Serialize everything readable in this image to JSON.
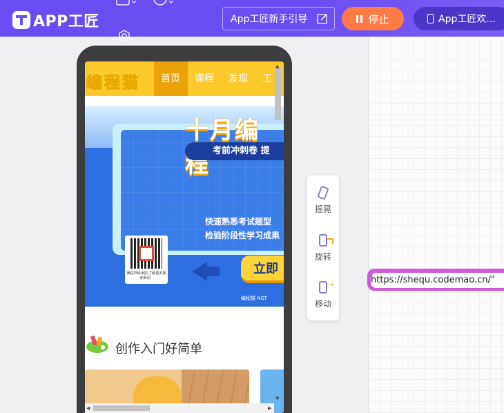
{
  "header": {
    "logo_text": "APP工匠",
    "guide_label": "App工匠新手引导",
    "stop_label": "停止",
    "app_label": "App工匠欢..."
  },
  "phone_screen": {
    "brand": "编程猫",
    "nav": [
      "首页",
      "课程",
      "发现",
      "工"
    ],
    "banner": {
      "title": "十月编程",
      "pill": "考前冲刺卷 提",
      "line1": "快速熟悉考试题型",
      "line2": "检验阶段性学习成果",
      "qr_caption": "微信扫码添加 了解更多报考资讯！",
      "button": "立即",
      "footer": "编程猫 NGT"
    },
    "section_title": "创作入门好简单"
  },
  "tools": {
    "shake": "摇晃",
    "rotate": "旋转",
    "move": "移动"
  },
  "url_value": "https://shequ.codemao.cn/\""
}
